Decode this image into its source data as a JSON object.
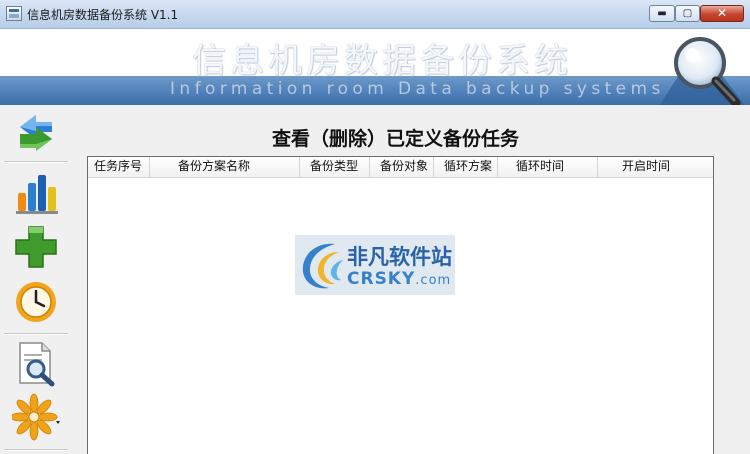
{
  "window": {
    "title": "信息机房数据备份系统 V1.1",
    "buttons": {
      "minimize": "▬",
      "maximize": "▢",
      "close": "✕"
    }
  },
  "banner": {
    "title_cn": "信息机房数据备份系统",
    "title_en": "Information room Data backup systems"
  },
  "toolbar": {
    "items": [
      {
        "icon": "refresh-arrows-icon"
      },
      {
        "icon": "bar-chart-icon"
      },
      {
        "icon": "green-plus-icon"
      },
      {
        "icon": "clock-icon"
      },
      {
        "icon": "document-search-icon"
      },
      {
        "icon": "flower-settings-icon"
      }
    ]
  },
  "main": {
    "title": "查看（删除）已定义备份任务",
    "table": {
      "columns": [
        "任务序号",
        "备份方案名称",
        "备份类型",
        "备份对象",
        "循环方案",
        "循环时间",
        "开启时间"
      ],
      "rows": []
    }
  },
  "watermark": {
    "cn": "非凡软件站",
    "en": "CRSKY",
    "en_suffix": ".com"
  },
  "colors": {
    "banner_blue": "#4e7fb8",
    "title_gradient_top": "#dbe7f5",
    "close_red": "#c7452e"
  }
}
